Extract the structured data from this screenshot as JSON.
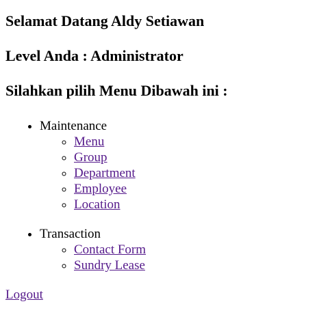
{
  "header": {
    "welcome": "Selamat Datang Aldy Setiawan",
    "level": "Level Anda : Administrator",
    "prompt": "Silahkan pilih Menu Dibawah ini :"
  },
  "menu": {
    "maintenance": {
      "label": "Maintenance",
      "items": [
        "Menu",
        "Group",
        "Department",
        "Employee",
        "Location"
      ]
    },
    "transaction": {
      "label": "Transaction",
      "items": [
        "Contact Form",
        "Sundry Lease"
      ]
    }
  },
  "logout": "Logout",
  "colors": {
    "visited_link": "#551a8b",
    "text": "#000000",
    "background": "#ffffff"
  }
}
